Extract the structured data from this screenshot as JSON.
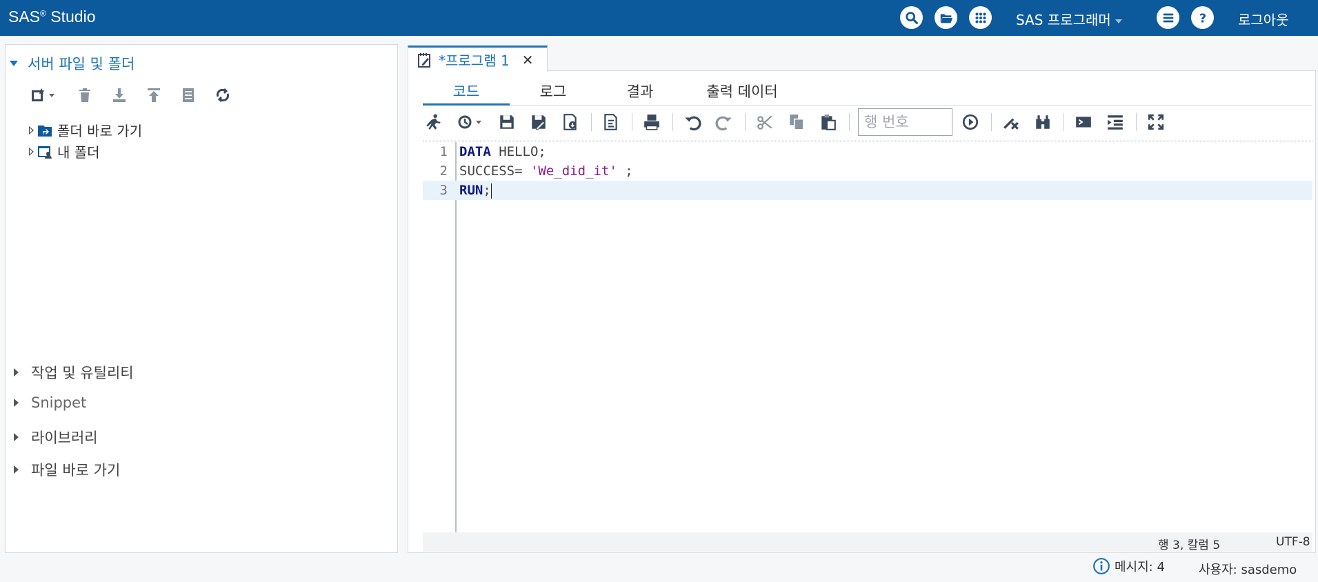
{
  "app": {
    "name": "SAS",
    "reg": "®",
    "product": "Studio"
  },
  "header": {
    "perspective": "SAS 프로그래머",
    "logout": "로그아웃"
  },
  "colors": {
    "topbar": "#0c5a9c",
    "accent": "#1c73b7",
    "keyword": "#0d1a80",
    "string": "#8b1a8b"
  },
  "left": {
    "server_section": "서버 파일 및 폴더",
    "tree": [
      {
        "label": "폴더 바로 가기",
        "icon": "folder-shortcut-icon"
      },
      {
        "label": "내 폴더",
        "icon": "my-folder-icon"
      }
    ],
    "sections": [
      "작업 및 유틸리티",
      "Snippet",
      "라이브러리",
      "파일 바로 가기"
    ]
  },
  "editor_tab": {
    "title": "*프로그램 1",
    "close": "✕"
  },
  "subtabs": [
    "코드",
    "로그",
    "결과",
    "출력 데이터"
  ],
  "toolbar": {
    "line_placeholder": "행 번호"
  },
  "code": {
    "line_numbers": [
      "1",
      "2",
      "3"
    ],
    "line1_kw": "DATA",
    "line1_rest": " HELLO;",
    "line2_pre": "SUCCESS= ",
    "line2_str": "'We_did_it'",
    "line2_post": " ;",
    "line3_kw": "RUN",
    "line3_rest": ";"
  },
  "status": {
    "position": "행 3, 칼럼 5",
    "encoding": "UTF-8"
  },
  "footer": {
    "messages": "메시지: 4",
    "user": "사용자: sasdemo"
  }
}
